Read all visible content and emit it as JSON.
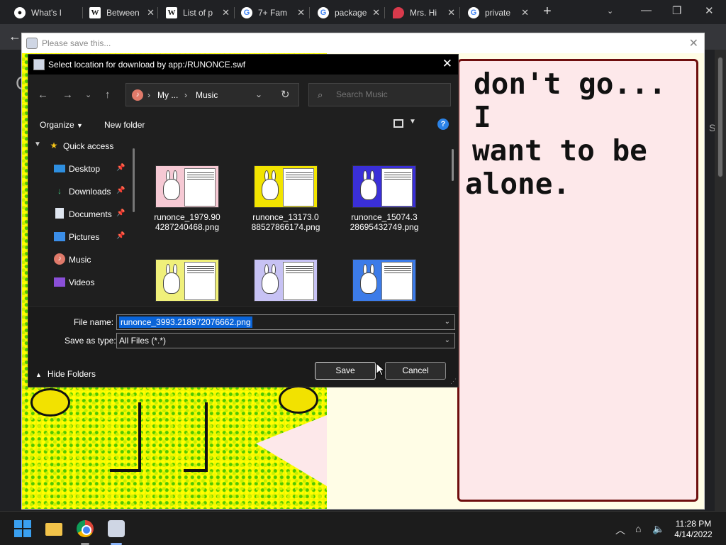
{
  "browser": {
    "tabs": [
      {
        "label": "What's I",
        "icon": "github-icon"
      },
      {
        "label": "Between",
        "icon": "wikipedia-icon"
      },
      {
        "label": "List of p",
        "icon": "wikipedia-icon"
      },
      {
        "label": "7+ Fam",
        "icon": "google-icon"
      },
      {
        "label": "package",
        "icon": "google-icon"
      },
      {
        "label": "Mrs. Hi",
        "icon": "reddit-icon"
      },
      {
        "label": "private",
        "icon": "google-icon"
      }
    ],
    "page_letter_left": "C",
    "page_letter_right": "S"
  },
  "flash_window": {
    "title": "Please save this...",
    "bubble_text_1": "don't go... I",
    "bubble_text_2": "want to be",
    "bubble_text_3": "alone."
  },
  "dialog": {
    "title": "Select location for download by app:/RUNONCE.swf",
    "breadcrumb": [
      "My ...",
      "Music"
    ],
    "search_placeholder": "Search Music",
    "organize_label": "Organize",
    "new_folder_label": "New folder",
    "nav_items": [
      {
        "label": "Quick access",
        "icon": "star-icon",
        "pinned": false
      },
      {
        "label": "Desktop",
        "icon": "desktop-icon",
        "pinned": true
      },
      {
        "label": "Downloads",
        "icon": "download-icon",
        "pinned": true
      },
      {
        "label": "Documents",
        "icon": "document-icon",
        "pinned": true
      },
      {
        "label": "Pictures",
        "icon": "picture-icon",
        "pinned": true
      },
      {
        "label": "Music",
        "icon": "music-icon",
        "pinned": false
      },
      {
        "label": "Videos",
        "icon": "video-icon",
        "pinned": false
      }
    ],
    "files": [
      {
        "name": "runonce_1979.904287240468.png",
        "name_l1": "runonce_1979.90",
        "name_l2": "4287240468.png",
        "bg": "#f6c9d4"
      },
      {
        "name": "runonce_13173.088527866174.png",
        "name_l1": "runonce_13173.0",
        "name_l2": "88527866174.png",
        "bg": "#f2e400"
      },
      {
        "name": "runonce_15074.328695432749.png",
        "name_l1": "runonce_15074.3",
        "name_l2": "28695432749.png",
        "bg": "#3a2fd8"
      },
      {
        "name": "",
        "name_l1": "",
        "name_l2": "",
        "bg": "#f0f07a"
      },
      {
        "name": "",
        "name_l1": "",
        "name_l2": "",
        "bg": "#c7c2f4"
      },
      {
        "name": "",
        "name_l1": "",
        "name_l2": "",
        "bg": "#3c7be8"
      }
    ],
    "file_name_label": "File name:",
    "file_name_value": "runonce_3993.218972076662.png",
    "save_type_label": "Save as type:",
    "save_type_value": "All Files (*.*)",
    "hide_folders_label": "Hide Folders",
    "save_label": "Save",
    "cancel_label": "Cancel"
  },
  "taskbar": {
    "time": "11:28 PM",
    "date": "4/14/2022"
  }
}
